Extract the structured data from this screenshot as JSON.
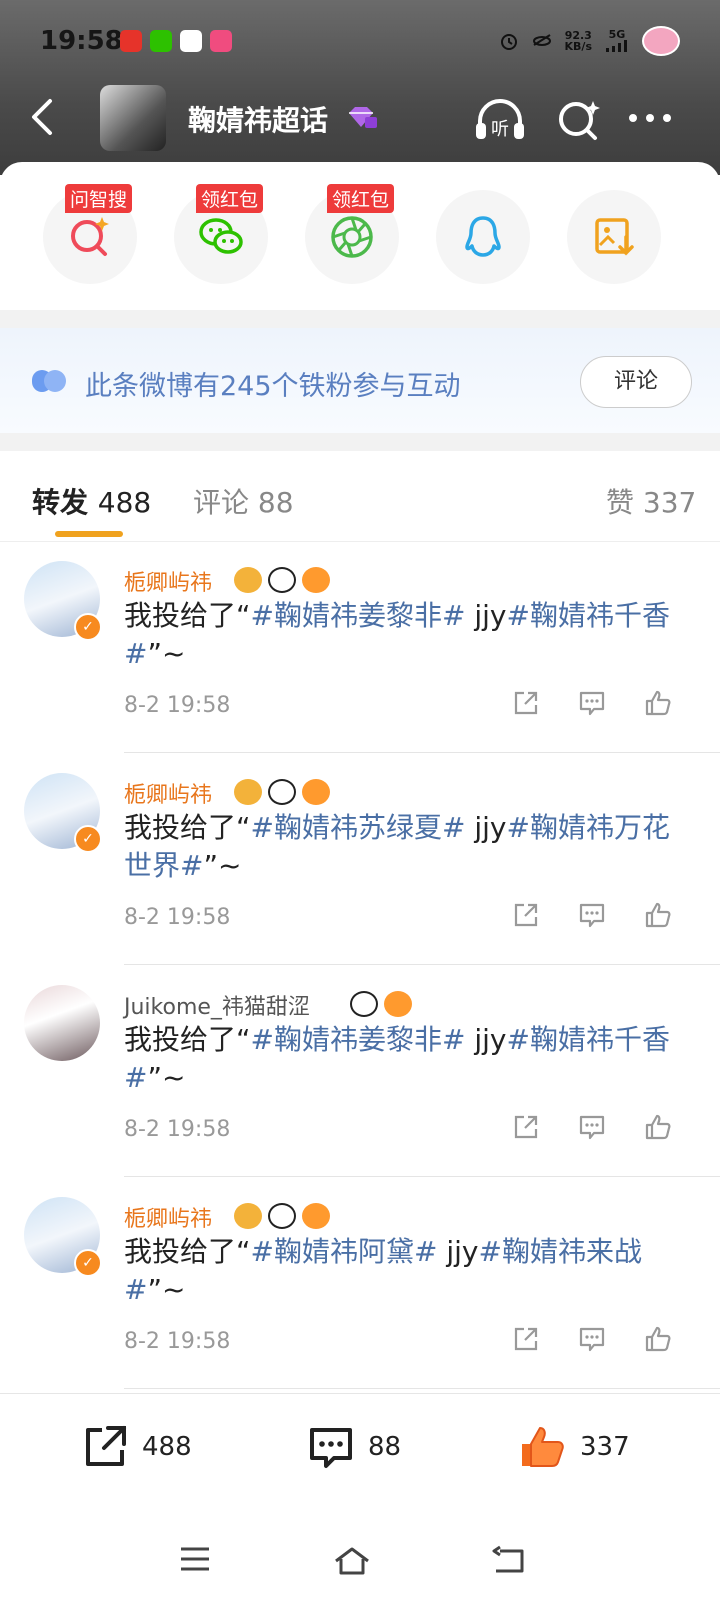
{
  "status_bar": {
    "time": "19:58",
    "net_speed_value": "92.3",
    "net_speed_unit": "KB/s",
    "network": "5G"
  },
  "header": {
    "title": "鞠婧祎超话"
  },
  "shortcuts": [
    {
      "tag": "问智搜",
      "icon": "search-spark-icon"
    },
    {
      "tag": "领红包",
      "icon": "wechat-icon"
    },
    {
      "tag": "领红包",
      "icon": "moments-icon"
    },
    {
      "tag": "",
      "icon": "qq-icon"
    },
    {
      "tag": "",
      "icon": "save-image-icon"
    }
  ],
  "banner": {
    "text": "此条微博有245个铁粉参与互动",
    "button": "评论"
  },
  "tabs": {
    "repost_label": "转发",
    "repost_count": "488",
    "comment_label": "评论",
    "comment_count": "88",
    "like_label": "赞",
    "like_count": "337"
  },
  "feed": [
    {
      "name": "栀卿屿祎",
      "pre": "我投给了“",
      "tag1": "#鞠婧祎姜黎非#",
      "mid": " jjy",
      "tag2": "#鞠婧祎千香#",
      "post": "”~",
      "time": "8-2 19:58"
    },
    {
      "name": "栀卿屿祎",
      "pre": "我投给了“",
      "tag1": "#鞠婧祎苏绿夏#",
      "mid": " jjy",
      "tag2": "#鞠婧祎万花世界#",
      "post": "”~",
      "time": "8-2 19:58"
    },
    {
      "name": "Juikome_祎猫甜涩",
      "pre": "我投给了“",
      "tag1": "#鞠婧祎姜黎非#",
      "mid": " jjy",
      "tag2": "#鞠婧祎千香#",
      "post": "”~",
      "time": "8-2 19:58"
    },
    {
      "name": "栀卿屿祎",
      "pre": "我投给了“",
      "tag1": "#鞠婧祎阿黛#",
      "mid": " jjy",
      "tag2": "#鞠婧祎来战#",
      "post": "”~",
      "time": "8-2 19:58"
    }
  ],
  "bottom_bar": {
    "repost_count": "488",
    "comment_count": "88",
    "like_count": "337"
  },
  "colors": {
    "accent_orange": "#f0a21e",
    "hashtag_blue": "#4a6fa5",
    "username_orange": "#e8761c",
    "banner_text": "#5a7fc0"
  }
}
